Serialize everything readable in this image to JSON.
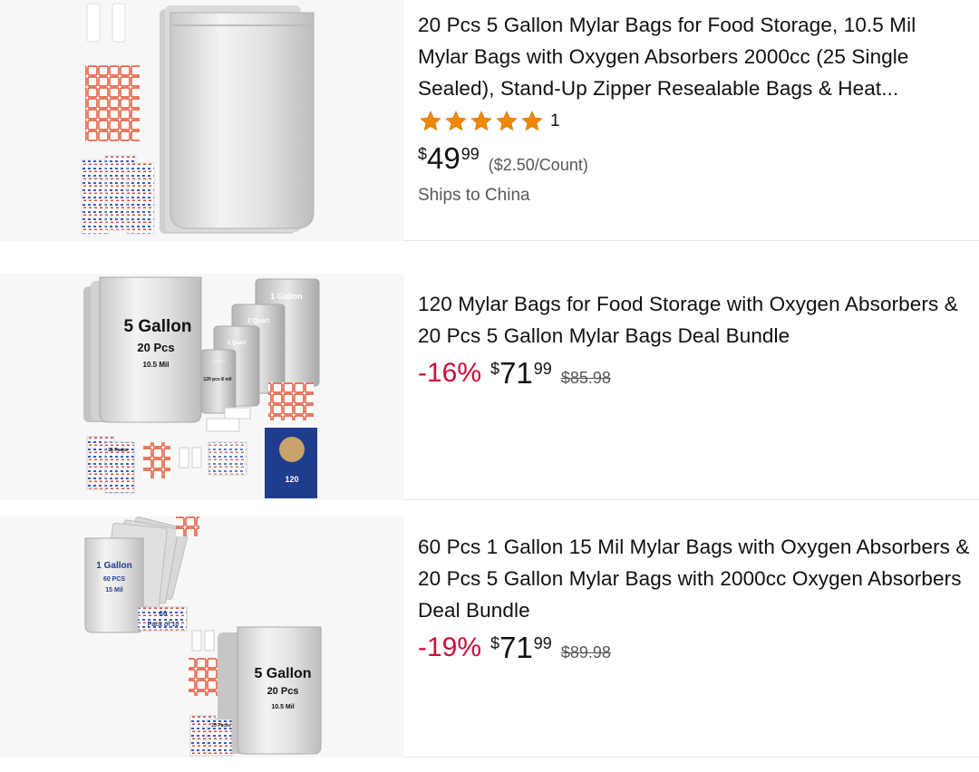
{
  "products": [
    {
      "image_alt": "5 gallon mylar bags with oxygen absorbers and labels",
      "title": "20 Pcs 5 Gallon Mylar Bags for Food Storage, 10.5 Mil Mylar Bags with Oxygen Absorbers 2000cc (25 Single Sealed), Stand-Up Zipper Resealable Bags & Heat...",
      "rating": 5,
      "rating_count": "1",
      "price_currency": "$",
      "price_whole": "49",
      "price_fraction": "99",
      "unit_price": "($2.50/Count)",
      "shipping": "Ships to China"
    },
    {
      "image_text": {
        "size": "5 Gallon",
        "count": "20 Pcs",
        "mil": "10.5 Mil",
        "one_gallon": "1 Gallon",
        "two_quart": "2 Quart",
        "one_quart": "1 Quart",
        "half_pint": "1/2 Pint",
        "inner": "120 pcs 8 mil",
        "packs": "25 Packs",
        "bundle": "120"
      },
      "title": "120 Mylar Bags for Food Storage with Oxygen Absorbers & 20 Pcs 5 Gallon Mylar Bags Deal Bundle",
      "discount": "-16%",
      "price_currency": "$",
      "price_whole": "71",
      "price_fraction": "99",
      "list_price": "$85.98"
    },
    {
      "image_text": {
        "one_gallon": "1 Gallon",
        "sixty_pcs": "60 PCS",
        "fifteen_mil": "15 Mil",
        "sixty": "60",
        "pack_of": "Pack of 10",
        "size": "5 Gallon",
        "count": "20 Pcs",
        "mil": "10.5 Mil",
        "packs": "25 Packs"
      },
      "title": "60 Pcs 1 Gallon 15 Mil Mylar Bags with Oxygen Absorbers & 20 Pcs 5 Gallon Mylar Bags with 2000cc Oxygen Absorbers Deal Bundle",
      "discount": "-19%",
      "price_currency": "$",
      "price_whole": "71",
      "price_fraction": "99",
      "list_price": "$89.98"
    }
  ],
  "colors": {
    "star": "#f08804",
    "discount": "#cc0c39",
    "muted": "#565959"
  }
}
